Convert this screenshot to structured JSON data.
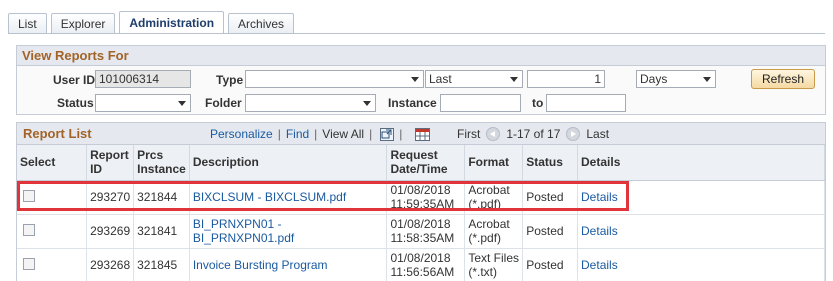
{
  "tabs": [
    {
      "label": "List"
    },
    {
      "label": "Explorer"
    },
    {
      "label": "Administration"
    },
    {
      "label": "Archives"
    }
  ],
  "view_reports": {
    "title": "View Reports For",
    "user_id_label": "User ID",
    "user_id_value": "101006314",
    "type_label": "Type",
    "type_value": "",
    "last_value": "Last",
    "count_value": "1",
    "unit_value": "Days",
    "refresh_label": "Refresh",
    "status_label": "Status",
    "status_value": "",
    "folder_label": "Folder",
    "folder_value": "",
    "instance_label": "Instance",
    "instance_from": "",
    "to_label": "to",
    "instance_to": ""
  },
  "report_list": {
    "title": "Report List",
    "personalize": "Personalize",
    "find": "Find",
    "view_all": "View All",
    "first": "First",
    "range": "1-17 of 17",
    "last": "Last",
    "columns": {
      "select": "Select",
      "report_id": "Report ID",
      "prcs_instance": "Prcs Instance",
      "description": "Description",
      "request_datetime": "Request Date/Time",
      "format": "Format",
      "status": "Status",
      "details": "Details"
    },
    "rows": [
      {
        "report_id": "293270",
        "prcs": "321844",
        "description": "BIXCLSUM - BIXCLSUM.pdf",
        "date": "01/08/2018",
        "time": "11:59:35AM",
        "format1": "Acrobat",
        "format2": "(*.pdf)",
        "status": "Posted",
        "details": "Details"
      },
      {
        "report_id": "293269",
        "prcs": "321841",
        "description": "BI_PRNXPN01 - BI_PRNXPN01.pdf",
        "date": "01/08/2018",
        "time": "11:58:35AM",
        "format1": "Acrobat",
        "format2": "(*.pdf)",
        "status": "Posted",
        "details": "Details"
      },
      {
        "report_id": "293268",
        "prcs": "321845",
        "description": "Invoice Bursting Program",
        "date": "01/08/2018",
        "time": "11:56:56AM",
        "format1": "Text Files",
        "format2": "(*.txt)",
        "status": "Posted",
        "details": "Details"
      }
    ]
  },
  "colors": {
    "section_title": "#a36326",
    "link": "#1a5aa0",
    "highlight": "#e0333a"
  }
}
